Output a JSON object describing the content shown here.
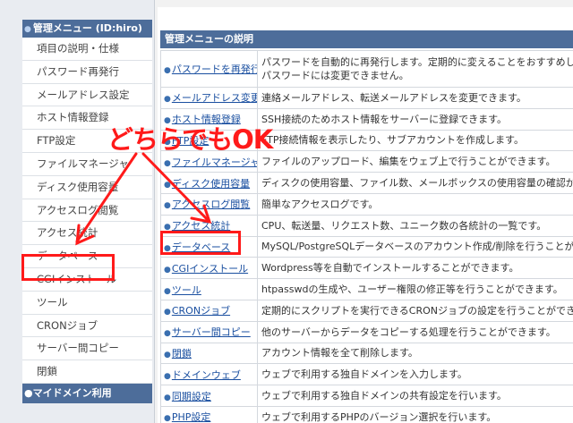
{
  "sidebar": {
    "header": "管理メニュー (ID:hiro)",
    "items": [
      {
        "label": "項目の説明・仕様"
      },
      {
        "label": "パスワード再発行"
      },
      {
        "label": "メールアドレス設定"
      },
      {
        "label": "ホスト情報登録"
      },
      {
        "label": "FTP設定"
      },
      {
        "label": "ファイルマネージャ"
      },
      {
        "label": "ディスク使用容量"
      },
      {
        "label": "アクセスログ閲覧"
      },
      {
        "label": "アクセス統計"
      },
      {
        "label": "データベース"
      },
      {
        "label": "CGIインストール"
      },
      {
        "label": "ツール"
      },
      {
        "label": "CRONジョブ"
      },
      {
        "label": "サーバー間コピー"
      },
      {
        "label": "閉鎖"
      }
    ],
    "footer": "マイドメイン利用"
  },
  "main": {
    "header": "管理メニューの説明",
    "rows": [
      {
        "name": "パスワードを再発行",
        "desc1": "パスワードを自動的に再発行します。定期的に変えることをおすすめします。",
        "desc2": "パスワードには変更できません。"
      },
      {
        "name": "メールアドレス変更",
        "desc1": "連絡メールアドレス、転送メールアドレスを変更できます。"
      },
      {
        "name": "ホスト情報登録",
        "desc1": "SSH接続のためホスト情報をサーバーに登録できます。"
      },
      {
        "name": "FTP設定",
        "desc1": "FTP接続情報を表示したり、サブアカウントを作成します。"
      },
      {
        "name": "ファイルマネージャ",
        "desc1": "ファイルのアップロード、編集をウェブ上で行うことができます。"
      },
      {
        "name": "ディスク使用容量",
        "desc1": "ディスクの使用容量、ファイル数、メールボックスの使用容量の確認ができます。"
      },
      {
        "name": "アクセスログ閲覧",
        "desc1": "簡単なアクセスログです。"
      },
      {
        "name": "アクセス統計",
        "desc1": "CPU、転送量、リクエスト数、ユニーク数の各統計の一覧です。"
      },
      {
        "name": "データベース",
        "desc1": "MySQL/PostgreSQLデータベースのアカウント作成/削除を行うことができます。"
      },
      {
        "name": "CGIインストール",
        "desc1": "Wordpress等を自動でインストールすることができます。"
      },
      {
        "name": "ツール",
        "desc1": "htpasswdの生成や、ユーザー権限の修正等を行うことができます。"
      },
      {
        "name": "CRONジョブ",
        "desc1": "定期的にスクリプトを実行できるCRONジョブの設定を行うことができます。"
      },
      {
        "name": "サーバー間コピー",
        "desc1": "他のサーバーからデータをコピーする処理を行うことができます。"
      },
      {
        "name": "閉鎖",
        "desc1": "アカウント情報を全て削除します。"
      },
      {
        "name": "ドメインウェブ",
        "desc1": "ウェブで利用する独自ドメインを入力します。"
      },
      {
        "name": "同期設定",
        "desc1": "ウェブで利用する独自ドメインの共有設定を行います。"
      },
      {
        "name": "PHP設定",
        "desc1": "ウェブで利用するPHPのバージョン選択を行います。"
      }
    ]
  },
  "annotation": {
    "text": "どちらでもOK",
    "color": "#ff1a1a"
  },
  "colors": {
    "header_blue": "#4d6d9a",
    "link": "#1a4fa0"
  }
}
